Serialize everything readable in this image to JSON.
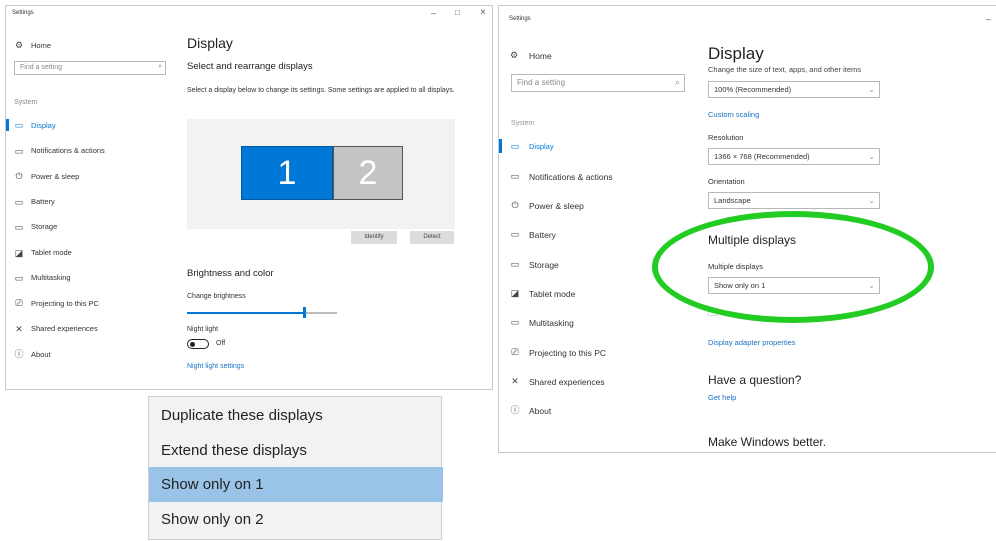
{
  "left_window": {
    "title": "Settings",
    "controls": [
      "–",
      "□",
      "×"
    ],
    "nav": {
      "home": "Home",
      "search_placeholder": "Find a setting",
      "section": "System",
      "items": [
        {
          "label": "Display",
          "icon": "monitor-icon"
        },
        {
          "label": "Notifications & actions",
          "icon": "notifications-icon"
        },
        {
          "label": "Power & sleep",
          "icon": "power-icon"
        },
        {
          "label": "Battery",
          "icon": "battery-icon"
        },
        {
          "label": "Storage",
          "icon": "storage-icon"
        },
        {
          "label": "Tablet mode",
          "icon": "tablet-icon"
        },
        {
          "label": "Multitasking",
          "icon": "multitasking-icon"
        },
        {
          "label": "Projecting to this PC",
          "icon": "projecting-icon"
        },
        {
          "label": "Shared experiences",
          "icon": "shared-icon"
        },
        {
          "label": "About",
          "icon": "about-icon"
        }
      ]
    },
    "content": {
      "title": "Display",
      "subtitle": "Select and rearrange displays",
      "description": "Select a display below to change its settings. Some settings are applied to all displays.",
      "monitor1": "1",
      "monitor2": "2",
      "identify": "Identify",
      "detect": "Detect",
      "brightness_heading": "Brightness and color",
      "brightness_label": "Change brightness",
      "brightness_value": 0.78,
      "night_light_label": "Night light",
      "night_light_state": "Off",
      "night_light_settings": "Night light settings"
    }
  },
  "dropdown_menu": {
    "items": [
      {
        "label": "Duplicate these displays",
        "selected": false
      },
      {
        "label": "Extend these displays",
        "selected": false
      },
      {
        "label": "Show only on 1",
        "selected": true
      },
      {
        "label": "Show only on 2",
        "selected": false
      }
    ]
  },
  "right_window": {
    "title": "Settings",
    "controls": "–",
    "nav": {
      "home": "Home",
      "search_placeholder": "Find a setting",
      "section": "System",
      "items": [
        {
          "label": "Display",
          "icon": "monitor-icon"
        },
        {
          "label": "Notifications & actions",
          "icon": "notifications-icon"
        },
        {
          "label": "Power & sleep",
          "icon": "power-icon"
        },
        {
          "label": "Battery",
          "icon": "battery-icon"
        },
        {
          "label": "Storage",
          "icon": "storage-icon"
        },
        {
          "label": "Tablet mode",
          "icon": "tablet-icon"
        },
        {
          "label": "Multitasking",
          "icon": "multitasking-icon"
        },
        {
          "label": "Projecting to this PC",
          "icon": "projecting-icon"
        },
        {
          "label": "Shared experiences",
          "icon": "shared-icon"
        },
        {
          "label": "About",
          "icon": "about-icon"
        }
      ]
    },
    "content": {
      "title": "Display",
      "scale_label": "Change the size of text, apps, and other items",
      "scale_value": "100% (Recommended)",
      "custom_scaling": "Custom scaling",
      "resolution_label": "Resolution",
      "resolution_value": "1366 × 768 (Recommended)",
      "orientation_label": "Orientation",
      "orientation_value": "Landscape",
      "multiple_heading": "Multiple displays",
      "multiple_label": "Multiple displays",
      "multiple_value": "Show only on 1",
      "adapter_link": "Display adapter properties",
      "question_heading": "Have a question?",
      "get_help": "Get help",
      "make_better": "Make Windows better."
    },
    "highlight_color": "#22cc22"
  },
  "colors": {
    "accent": "#0078d7",
    "monitor_inactive": "#c4c4c4",
    "menu_selected": "#99c4e8"
  }
}
